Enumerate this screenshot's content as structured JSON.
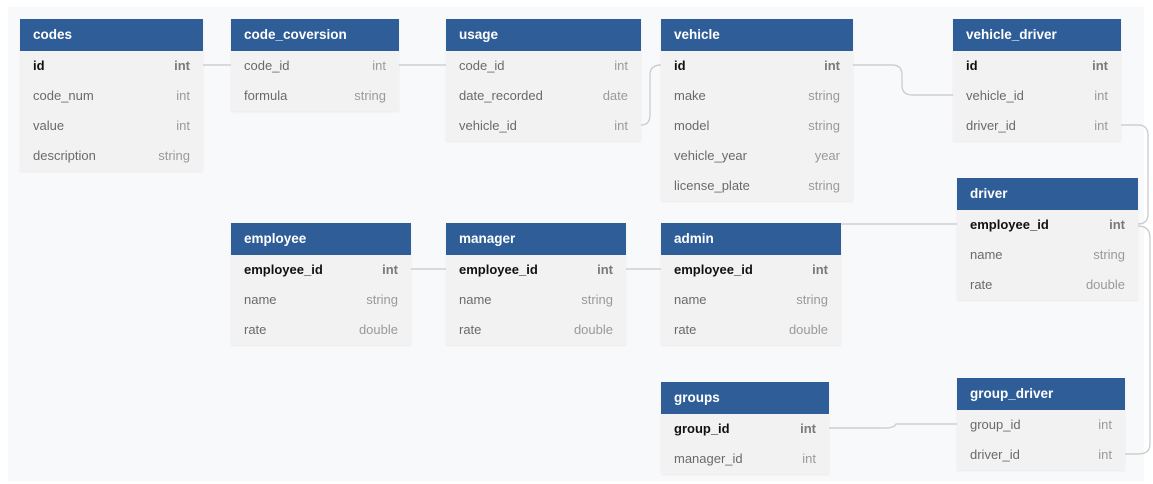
{
  "colors": {
    "header_bg": "#2e5d98",
    "header_text": "#ffffff",
    "row_bg": "#f2f2f2",
    "canvas_bg": "#f8f9fa",
    "connector": "#c8c8c8"
  },
  "tables": [
    {
      "id": "codes",
      "title": "codes",
      "fields": [
        {
          "name": "id",
          "type": "int",
          "pk": true
        },
        {
          "name": "code_num",
          "type": "int"
        },
        {
          "name": "value",
          "type": "int"
        },
        {
          "name": "description",
          "type": "string"
        }
      ]
    },
    {
      "id": "code_coversion",
      "title": "code_coversion",
      "fields": [
        {
          "name": "code_id",
          "type": "int"
        },
        {
          "name": "formula",
          "type": "string"
        }
      ]
    },
    {
      "id": "usage",
      "title": "usage",
      "fields": [
        {
          "name": "code_id",
          "type": "int"
        },
        {
          "name": "date_recorded",
          "type": "date"
        },
        {
          "name": "vehicle_id",
          "type": "int"
        }
      ]
    },
    {
      "id": "vehicle",
      "title": "vehicle",
      "fields": [
        {
          "name": "id",
          "type": "int",
          "pk": true
        },
        {
          "name": "make",
          "type": "string"
        },
        {
          "name": "model",
          "type": "string"
        },
        {
          "name": "vehicle_year",
          "type": "year"
        },
        {
          "name": "license_plate",
          "type": "string"
        }
      ]
    },
    {
      "id": "vehicle_driver",
      "title": "vehicle_driver",
      "fields": [
        {
          "name": "id",
          "type": "int",
          "pk": true
        },
        {
          "name": "vehicle_id",
          "type": "int"
        },
        {
          "name": "driver_id",
          "type": "int"
        }
      ]
    },
    {
      "id": "driver",
      "title": "driver",
      "fields": [
        {
          "name": "employee_id",
          "type": "int",
          "pk": true
        },
        {
          "name": "name",
          "type": "string"
        },
        {
          "name": "rate",
          "type": "double"
        }
      ]
    },
    {
      "id": "employee",
      "title": "employee",
      "fields": [
        {
          "name": "employee_id",
          "type": "int",
          "pk": true
        },
        {
          "name": "name",
          "type": "string"
        },
        {
          "name": "rate",
          "type": "double"
        }
      ]
    },
    {
      "id": "manager",
      "title": "manager",
      "fields": [
        {
          "name": "employee_id",
          "type": "int",
          "pk": true
        },
        {
          "name": "name",
          "type": "string"
        },
        {
          "name": "rate",
          "type": "double"
        }
      ]
    },
    {
      "id": "admin",
      "title": "admin",
      "fields": [
        {
          "name": "employee_id",
          "type": "int",
          "pk": true
        },
        {
          "name": "name",
          "type": "string"
        },
        {
          "name": "rate",
          "type": "double"
        }
      ]
    },
    {
      "id": "groups",
      "title": "groups",
      "fields": [
        {
          "name": "group_id",
          "type": "int",
          "pk": true
        },
        {
          "name": "manager_id",
          "type": "int"
        }
      ]
    },
    {
      "id": "group_driver",
      "title": "group_driver",
      "fields": [
        {
          "name": "group_id",
          "type": "int"
        },
        {
          "name": "driver_id",
          "type": "int"
        }
      ]
    }
  ]
}
